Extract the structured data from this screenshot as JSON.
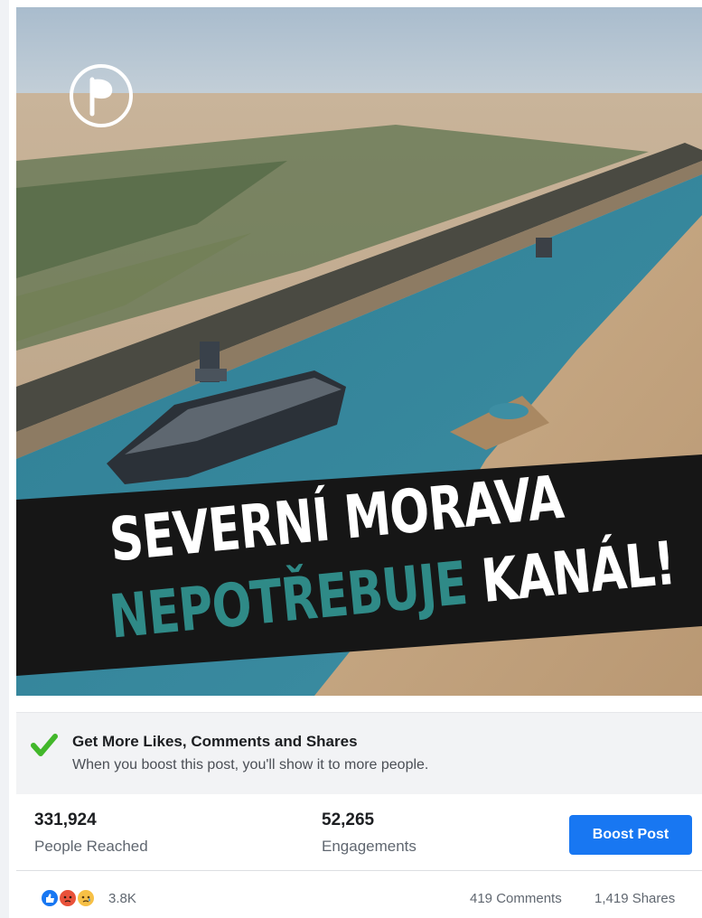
{
  "post": {
    "image": {
      "headline_line1": "SEVERNÍ MORAVA",
      "headline_line2_teal": "NEPOTŘEBUJE",
      "headline_line2_white": "KANÁL!",
      "logo_icon": "pirate-party-flag-icon"
    }
  },
  "boost_prompt": {
    "icon": "check-icon",
    "title": "Get More Likes, Comments and Shares",
    "subtitle": "When you boost this post, you'll show it to more people."
  },
  "stats": {
    "reached_value": "331,924",
    "reached_label": "People Reached",
    "engagements_value": "52,265",
    "engagements_label": "Engagements",
    "boost_button": "Boost Post"
  },
  "reactions": {
    "icons": [
      "like-icon",
      "angry-icon",
      "sad-icon"
    ],
    "count": "3.8K",
    "comments": "419 Comments",
    "shares": "1,419 Shares"
  },
  "colors": {
    "teal": "#2f8a87",
    "facebook_blue": "#1877f2",
    "check_green": "#42b72a"
  }
}
